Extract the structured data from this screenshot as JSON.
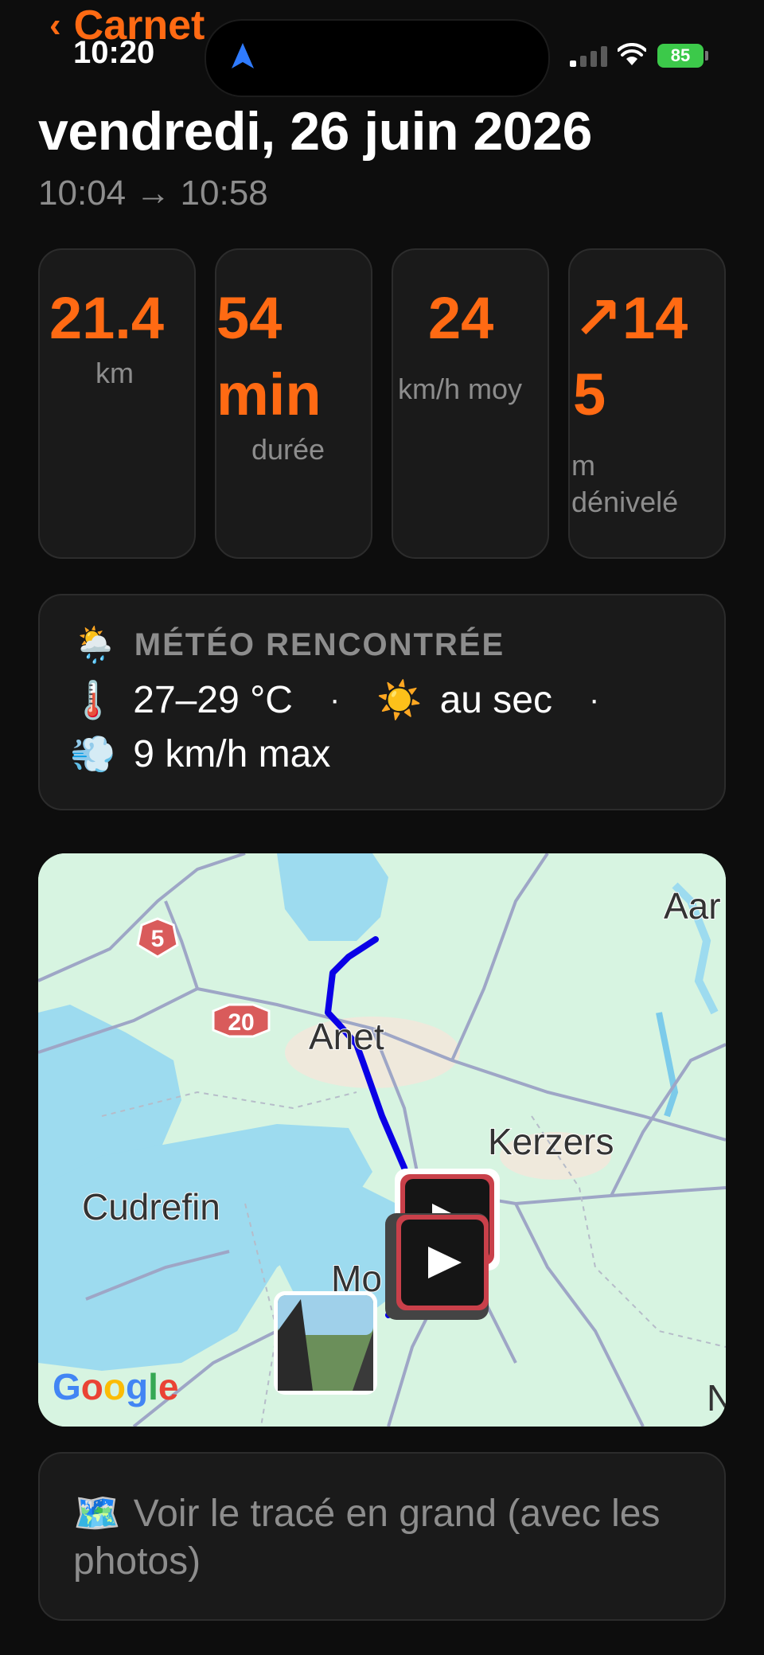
{
  "status_bar": {
    "back_label": "Carnet",
    "time": "10:20",
    "battery": "85"
  },
  "header": {
    "title": "vendredi, 26 juin 2026",
    "time_range": "10:04 → 10:58"
  },
  "stats": [
    {
      "value_lines": [
        "21.4"
      ],
      "label_lines": [
        "km"
      ]
    },
    {
      "value_lines": [
        "54",
        "min"
      ],
      "label_lines": [
        "durée"
      ]
    },
    {
      "value_lines": [
        "24"
      ],
      "label_lines": [
        "km/h moy"
      ]
    },
    {
      "value_lines": [
        "↗14",
        "5"
      ],
      "label_lines": [
        "m",
        "dénivelé"
      ]
    }
  ],
  "weather": {
    "icon": "🌦️",
    "heading": "MÉTÉO RENCONTRÉE",
    "temp_icon": "🌡️",
    "temperature": "27–29 °C",
    "sun_icon": "☀️",
    "condition": "au sec",
    "wind_icon": "💨",
    "wind": "9 km/h max",
    "separator": "·"
  },
  "map": {
    "labels": {
      "anet": "Anet",
      "kerzers": "Kerzers",
      "cudrefin": "Cudrefin",
      "murten": "Mo",
      "aar": "Aar",
      "n": "N",
      "road_5": "5",
      "road_20": "20",
      "google": "Google"
    },
    "colors": {
      "land": "#d7f4e1",
      "water": "#9ddbef",
      "route": "#0a00e6",
      "road": "#9ea6c6"
    }
  },
  "action": {
    "icon": "🗺️",
    "label": "Voir le tracé en grand (avec les photos)"
  },
  "colors": {
    "accent": "#ff6a13",
    "background": "#0d0d0d",
    "card": "#1a1a1a",
    "muted": "#8d8d8d"
  }
}
